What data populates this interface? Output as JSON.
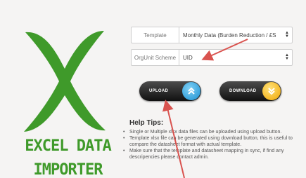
{
  "logo": {
    "line1": "EXCEL DATA",
    "line2": "IMPORTER"
  },
  "form": {
    "template_label": "Template",
    "template_value": "Monthly Data (Burden Reduction / £S",
    "orgunit_label": "OrgUnit Scheme",
    "orgunit_value": "UID"
  },
  "buttons": {
    "upload": "UPLOAD",
    "download": "DOWNLOAD"
  },
  "help": {
    "title": "Help Tips:",
    "tips": [
      "Single or Multiple xlsx data files can be uploaded using upload button.",
      "Template xlsx file can be generated using download button, this is useful to compare the datasheet format with actual template.",
      "Make sure that the template and datasheet mapping in sync, if find any descripencies please contact admin."
    ]
  },
  "colors": {
    "logo_green": "#3f9a2a",
    "upload_accent": "#1a8fd0",
    "download_accent": "#f0a500",
    "annotation_arrow": "#d9534f"
  },
  "icons": {
    "upload": "chevron-up-icon",
    "download": "chevron-down-icon",
    "select": "select-arrows-icon"
  }
}
